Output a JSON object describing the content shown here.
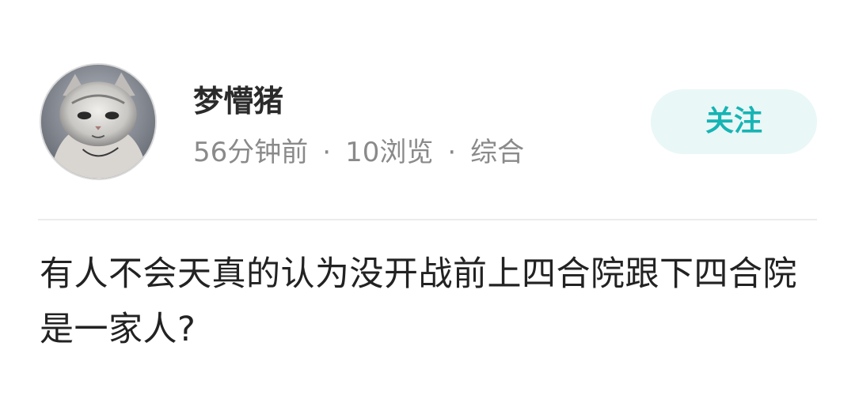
{
  "author": {
    "name": "梦懵猪",
    "avatar_icon": "cat-avatar"
  },
  "meta": {
    "time": "56分钟前",
    "separator": "·",
    "views": "10浏览",
    "category": "综合"
  },
  "actions": {
    "follow_label": "关注"
  },
  "post": {
    "text": "有人不会天真的认为没开战前上四合院跟下四合院是一家人?"
  },
  "colors": {
    "follow_text": "#17b4b4",
    "follow_bg": "#e9f7f7",
    "meta_text": "#8a8a8a"
  }
}
